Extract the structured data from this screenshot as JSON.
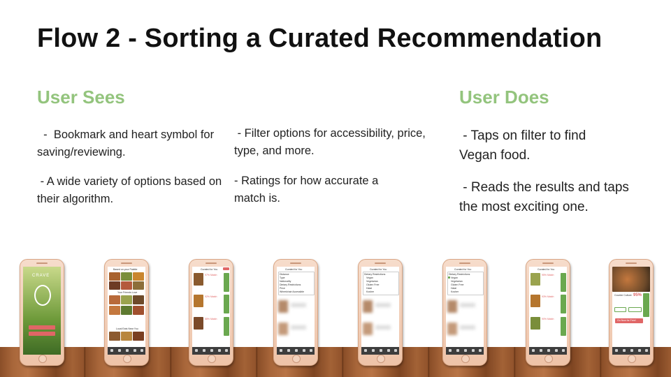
{
  "title": "Flow 2 - Sorting a Curated Recommendation",
  "sees": {
    "heading": "User Sees",
    "items": [
      "  -  Bookmark and heart symbol for saving/reviewing.",
      " - A wide variety of options based on their algorithm.",
      " - Filter options for accessibility, price, type, and more.",
      "- Ratings for how accurate a match is."
    ]
  },
  "does": {
    "heading": "User Does",
    "items": [
      " - Taps on filter to find Vegan food.",
      " - Reads the results and taps the most exciting one."
    ]
  },
  "phones": {
    "p1": {
      "brand": "CRAVE"
    },
    "p2": {
      "header": "Based on your Palette",
      "sub1": "Your Friends Love",
      "sub2": "Local Eats Near You"
    },
    "p3": {
      "header": "Curated for You",
      "badges": [
        "97% Match",
        "92% Match",
        "88% Match"
      ]
    },
    "p4": {
      "header": "Curated for You",
      "menu": [
        "Distance",
        "Type",
        "Nationality",
        "Dietary Restrictions",
        "Price",
        "Wheelchair Accessible"
      ]
    },
    "p5": {
      "header": "Curated for You",
      "menu": [
        "Dietary Restrictions",
        "Vegan",
        "Vegetarian",
        "Gluten Free",
        "Halal",
        "Kosher"
      ]
    },
    "p6": {
      "header": "Curated for You",
      "menu": [
        "Dietary Restrictions",
        "Vegan",
        "Vegetarian",
        "Gluten Free",
        "Halal",
        "Kosher"
      ]
    },
    "p7": {
      "header": "Curated for You",
      "badges": [
        "95% Match",
        "93% Match",
        "90% Match"
      ]
    },
    "p8": {
      "name": "Counter Culture",
      "match": "95%",
      "cta": "Go Now for Free!"
    }
  },
  "colors": {
    "accent_green": "#93c47d",
    "app_green": "#6aa84f",
    "app_red": "#e06666"
  }
}
